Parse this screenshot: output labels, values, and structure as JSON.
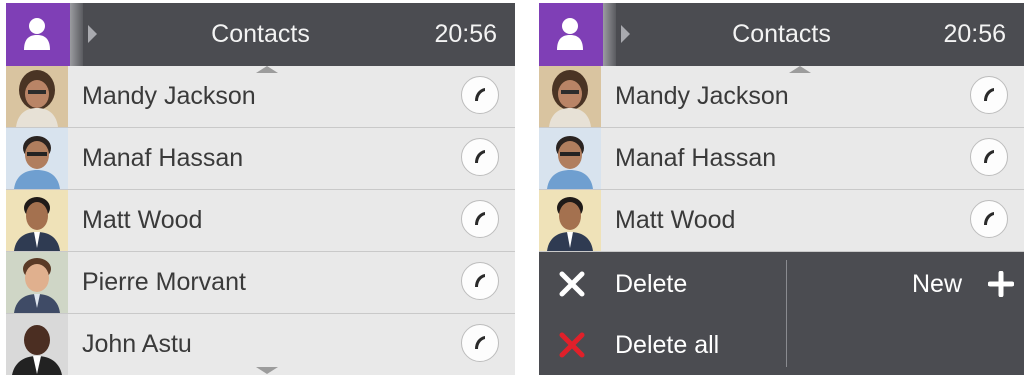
{
  "screens": [
    {
      "header": {
        "title": "Contacts",
        "time": "20:56",
        "contacts_icon": "person-icon",
        "expand_icon": "chevron-right-icon"
      },
      "contacts": [
        {
          "name": "Mandy Jackson",
          "call_icon": "phone-handset-icon"
        },
        {
          "name": "Manaf Hassan",
          "call_icon": "phone-handset-icon"
        },
        {
          "name": "Matt Wood",
          "call_icon": "phone-handset-icon"
        },
        {
          "name": "Pierre Morvant",
          "call_icon": "phone-handset-icon"
        },
        {
          "name": "John Astu",
          "call_icon": "phone-handset-icon"
        }
      ]
    },
    {
      "header": {
        "title": "Contacts",
        "time": "20:56",
        "contacts_icon": "person-icon",
        "expand_icon": "chevron-right-icon"
      },
      "contacts": [
        {
          "name": "Mandy Jackson",
          "call_icon": "phone-handset-icon"
        },
        {
          "name": "Manaf Hassan",
          "call_icon": "phone-handset-icon"
        },
        {
          "name": "Matt Wood",
          "call_icon": "phone-handset-icon"
        }
      ],
      "actions": {
        "delete": {
          "label": "Delete",
          "icon": "x-icon",
          "color": "#ffffff"
        },
        "delete_all": {
          "label": "Delete all",
          "icon": "x-icon",
          "color": "#e0202a"
        },
        "new": {
          "label": "New",
          "icon": "plus-icon",
          "color": "#ffffff"
        }
      }
    }
  ],
  "colors": {
    "header_bg": "#4b4c51",
    "accent_purple": "#7f3fb6",
    "list_bg": "#e9e9e9",
    "delete_all_red": "#e0202a"
  }
}
